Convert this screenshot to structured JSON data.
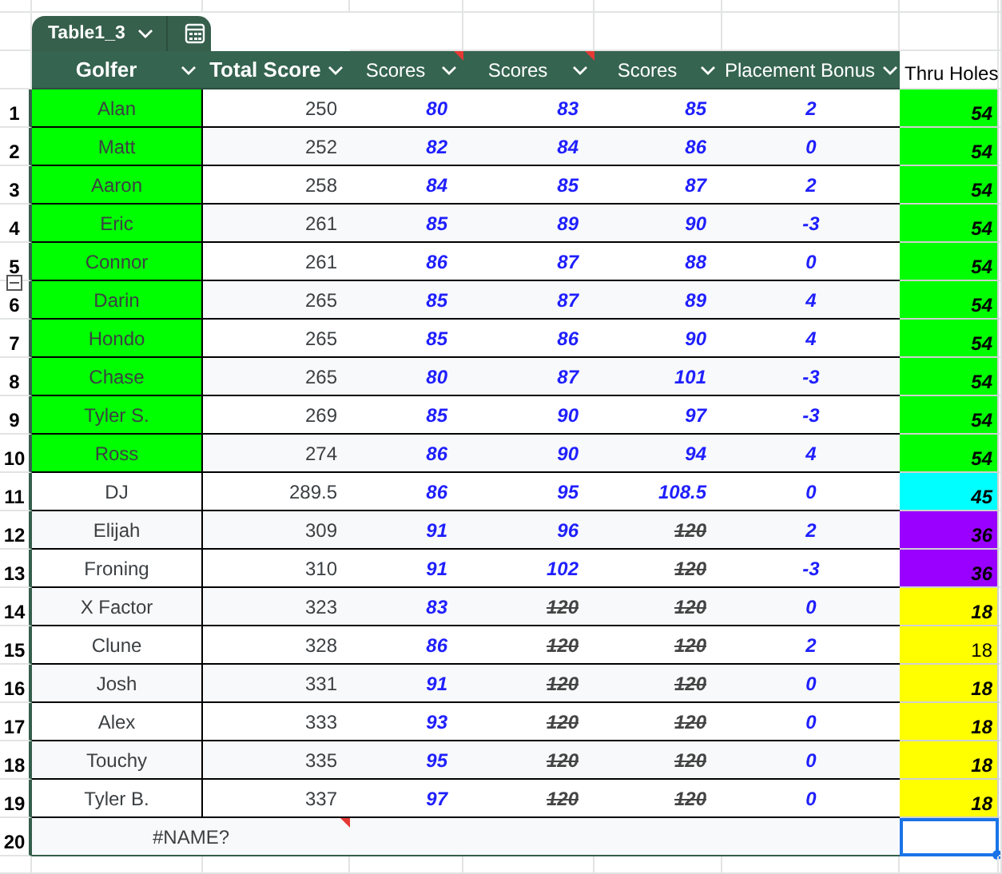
{
  "table": {
    "name": "Table1_3",
    "columns": [
      {
        "label": "Golfer",
        "bold": true,
        "has_note": false
      },
      {
        "label": "Total Score",
        "bold": true,
        "has_note": false
      },
      {
        "label": "Scores",
        "bold": false,
        "has_note": true
      },
      {
        "label": "Scores",
        "bold": false,
        "has_note": true
      },
      {
        "label": "Scores",
        "bold": false,
        "has_note": false
      },
      {
        "label": "Placement Bonus",
        "bold": false,
        "has_note": false
      }
    ],
    "rows": [
      {
        "golfer": "Alan",
        "color": "#00ff00",
        "total": "250",
        "scores": [
          {
            "value": "80",
            "struck": false
          },
          {
            "value": "83",
            "struck": false
          },
          {
            "value": "85",
            "struck": false
          }
        ],
        "bonus": "2"
      },
      {
        "golfer": "Matt",
        "color": "#00ff00",
        "total": "252",
        "scores": [
          {
            "value": "82",
            "struck": false
          },
          {
            "value": "84",
            "struck": false
          },
          {
            "value": "86",
            "struck": false
          }
        ],
        "bonus": "0"
      },
      {
        "golfer": "Aaron",
        "color": "#00ff00",
        "total": "258",
        "scores": [
          {
            "value": "84",
            "struck": false
          },
          {
            "value": "85",
            "struck": false
          },
          {
            "value": "87",
            "struck": false
          }
        ],
        "bonus": "2"
      },
      {
        "golfer": "Eric",
        "color": "#00ff00",
        "total": "261",
        "scores": [
          {
            "value": "85",
            "struck": false
          },
          {
            "value": "89",
            "struck": false
          },
          {
            "value": "90",
            "struck": false
          }
        ],
        "bonus": "-3"
      },
      {
        "golfer": "Connor",
        "color": "#00ff00",
        "total": "261",
        "scores": [
          {
            "value": "86",
            "struck": false
          },
          {
            "value": "87",
            "struck": false
          },
          {
            "value": "88",
            "struck": false
          }
        ],
        "bonus": "0"
      },
      {
        "golfer": "Darin",
        "color": "#00ff00",
        "total": "265",
        "scores": [
          {
            "value": "85",
            "struck": false
          },
          {
            "value": "87",
            "struck": false
          },
          {
            "value": "89",
            "struck": false
          }
        ],
        "bonus": "4"
      },
      {
        "golfer": "Hondo",
        "color": "#00ff00",
        "total": "265",
        "scores": [
          {
            "value": "85",
            "struck": false
          },
          {
            "value": "86",
            "struck": false
          },
          {
            "value": "90",
            "struck": false
          }
        ],
        "bonus": "4"
      },
      {
        "golfer": "Chase",
        "color": "#00ff00",
        "total": "265",
        "scores": [
          {
            "value": "80",
            "struck": false
          },
          {
            "value": "87",
            "struck": false
          },
          {
            "value": "101",
            "struck": false
          }
        ],
        "bonus": "-3"
      },
      {
        "golfer": "Tyler S.",
        "color": "#00ff00",
        "total": "269",
        "scores": [
          {
            "value": "85",
            "struck": false
          },
          {
            "value": "90",
            "struck": false
          },
          {
            "value": "97",
            "struck": false
          }
        ],
        "bonus": "-3"
      },
      {
        "golfer": "Ross",
        "color": "#00ff00",
        "total": "274",
        "scores": [
          {
            "value": "86",
            "struck": false
          },
          {
            "value": "90",
            "struck": false
          },
          {
            "value": "94",
            "struck": false
          }
        ],
        "bonus": "4"
      },
      {
        "golfer": "DJ",
        "total": "289.5",
        "scores": [
          {
            "value": "86",
            "struck": false
          },
          {
            "value": "95",
            "struck": false
          },
          {
            "value": "108.5",
            "struck": false
          }
        ],
        "bonus": "0"
      },
      {
        "golfer": "Elijah",
        "total": "309",
        "scores": [
          {
            "value": "91",
            "struck": false
          },
          {
            "value": "96",
            "struck": false
          },
          {
            "value": "120",
            "struck": true
          }
        ],
        "bonus": "2"
      },
      {
        "golfer": "Froning",
        "total": "310",
        "scores": [
          {
            "value": "91",
            "struck": false
          },
          {
            "value": "102",
            "struck": false
          },
          {
            "value": "120",
            "struck": true
          }
        ],
        "bonus": "-3"
      },
      {
        "golfer": "X Factor",
        "total": "323",
        "scores": [
          {
            "value": "83",
            "struck": false
          },
          {
            "value": "120",
            "struck": true
          },
          {
            "value": "120",
            "struck": true
          }
        ],
        "bonus": "0"
      },
      {
        "golfer": "Clune",
        "total": "328",
        "scores": [
          {
            "value": "86",
            "struck": false
          },
          {
            "value": "120",
            "struck": true
          },
          {
            "value": "120",
            "struck": true
          }
        ],
        "bonus": "2"
      },
      {
        "golfer": "Josh",
        "total": "331",
        "scores": [
          {
            "value": "91",
            "struck": false
          },
          {
            "value": "120",
            "struck": true
          },
          {
            "value": "120",
            "struck": true
          }
        ],
        "bonus": "0"
      },
      {
        "golfer": "Alex",
        "total": "333",
        "scores": [
          {
            "value": "93",
            "struck": false
          },
          {
            "value": "120",
            "struck": true
          },
          {
            "value": "120",
            "struck": true
          }
        ],
        "bonus": "0"
      },
      {
        "golfer": "Touchy",
        "total": "335",
        "scores": [
          {
            "value": "95",
            "struck": false
          },
          {
            "value": "120",
            "struck": true
          },
          {
            "value": "120",
            "struck": true
          }
        ],
        "bonus": "0"
      },
      {
        "golfer": "Tyler B.",
        "total": "337",
        "scores": [
          {
            "value": "97",
            "struck": false
          },
          {
            "value": "120",
            "struck": true
          },
          {
            "value": "120",
            "struck": true
          }
        ],
        "bonus": "0"
      }
    ],
    "footer": {
      "text": "#NAME?",
      "has_note": true
    }
  },
  "row_numbers": [
    "1",
    "2",
    "3",
    "4",
    "5",
    "6",
    "7",
    "8",
    "9",
    "10",
    "11",
    "12",
    "13",
    "14",
    "15",
    "16",
    "17",
    "18",
    "19",
    "20"
  ],
  "side_column": {
    "header": "Thru Holes",
    "cells": [
      {
        "value": "54",
        "color": "#00ff00",
        "italic": true
      },
      {
        "value": "54",
        "color": "#00ff00",
        "italic": true
      },
      {
        "value": "54",
        "color": "#00ff00",
        "italic": true
      },
      {
        "value": "54",
        "color": "#00ff00",
        "italic": true
      },
      {
        "value": "54",
        "color": "#00ff00",
        "italic": true
      },
      {
        "value": "54",
        "color": "#00ff00",
        "italic": true
      },
      {
        "value": "54",
        "color": "#00ff00",
        "italic": true
      },
      {
        "value": "54",
        "color": "#00ff00",
        "italic": true
      },
      {
        "value": "54",
        "color": "#00ff00",
        "italic": true
      },
      {
        "value": "54",
        "color": "#00ff00",
        "italic": true
      },
      {
        "value": "45",
        "color": "#00ffff",
        "italic": true
      },
      {
        "value": "36",
        "color": "#9900ff",
        "italic": true
      },
      {
        "value": "36",
        "color": "#9900ff",
        "italic": true
      },
      {
        "value": "18",
        "color": "#ffff00",
        "italic": true
      },
      {
        "value": "18",
        "color": "#ffff00",
        "italic": false
      },
      {
        "value": "18",
        "color": "#ffff00",
        "italic": true
      },
      {
        "value": "18",
        "color": "#ffff00",
        "italic": true
      },
      {
        "value": "18",
        "color": "#ffff00",
        "italic": true
      },
      {
        "value": "18",
        "color": "#ffff00",
        "italic": true
      },
      {
        "selected": true
      }
    ]
  }
}
